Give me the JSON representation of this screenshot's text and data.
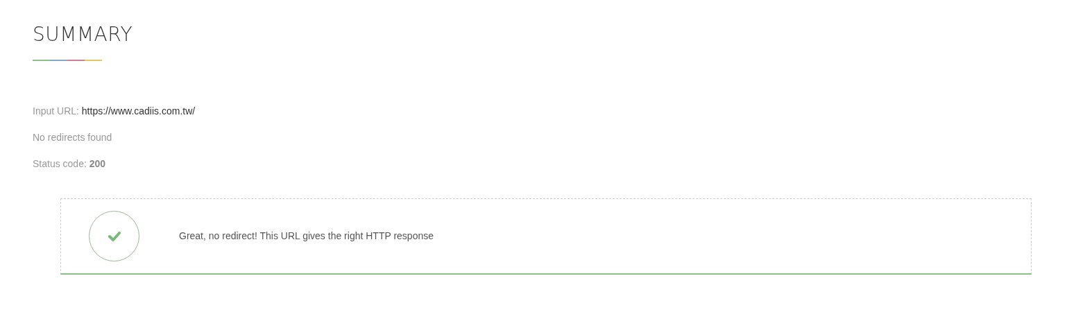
{
  "title": "SUMMARY",
  "details": [
    {
      "kind": "url",
      "label": "Input URL:",
      "value": "https://www.cadiis.com.tw/"
    },
    {
      "kind": "note",
      "label": "No redirects found"
    },
    {
      "kind": "code",
      "label": "Status code:",
      "value": "200"
    }
  ],
  "result": {
    "kind": "success",
    "message": "Great, no redirect! This URL gives the right HTTP response"
  }
}
